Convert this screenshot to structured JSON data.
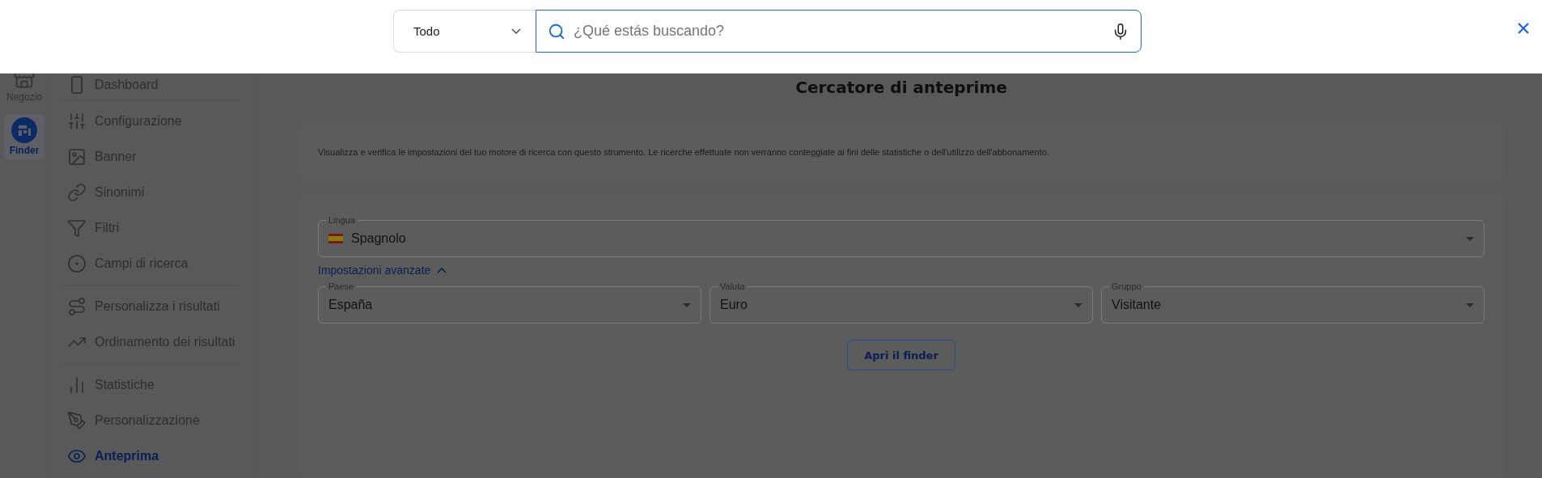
{
  "search_bar": {
    "scope": "Todo",
    "placeholder": "¿Qué estás buscando?"
  },
  "rail": [
    {
      "label": "Negozio",
      "selected": false
    },
    {
      "label": "Finder",
      "selected": true
    }
  ],
  "sidebar": {
    "sections": [
      {
        "items": [
          {
            "label": "Dashboard",
            "selected": false
          }
        ]
      },
      {
        "items": [
          {
            "label": "Configurazione",
            "selected": false
          },
          {
            "label": "Banner",
            "selected": false
          },
          {
            "label": "Sinonimi",
            "selected": false
          },
          {
            "label": "Filtri",
            "selected": false
          },
          {
            "label": "Campi di ricerca",
            "selected": false
          }
        ]
      },
      {
        "items": [
          {
            "label": "Personalizza i risultati",
            "selected": false
          },
          {
            "label": "Ordinamento dei risultati",
            "selected": false
          }
        ]
      },
      {
        "items": [
          {
            "label": "Statistiche",
            "selected": false
          },
          {
            "label": "Personalizzazione",
            "selected": false
          },
          {
            "label": "Anteprima",
            "selected": true
          }
        ]
      }
    ]
  },
  "page": {
    "title": "Cercatore di anteprime",
    "description": "Visualizza e verifica le impostazioni del tuo motore di ricerca con questo strumento. Le ricerche effettuate non verranno conteggiate ai fini delle statistiche o dell'utilizzo dell'abbonamento.",
    "language": {
      "label": "Lingua",
      "value": "Spagnolo"
    },
    "advanced": {
      "label": "Impostazioni avanzate",
      "expanded": true
    },
    "fields": [
      {
        "label": "Paese",
        "value": "España"
      },
      {
        "label": "Valuta",
        "value": "Euro"
      },
      {
        "label": "Gruppo",
        "value": "Visitante"
      }
    ],
    "button": "Apri il finder"
  }
}
